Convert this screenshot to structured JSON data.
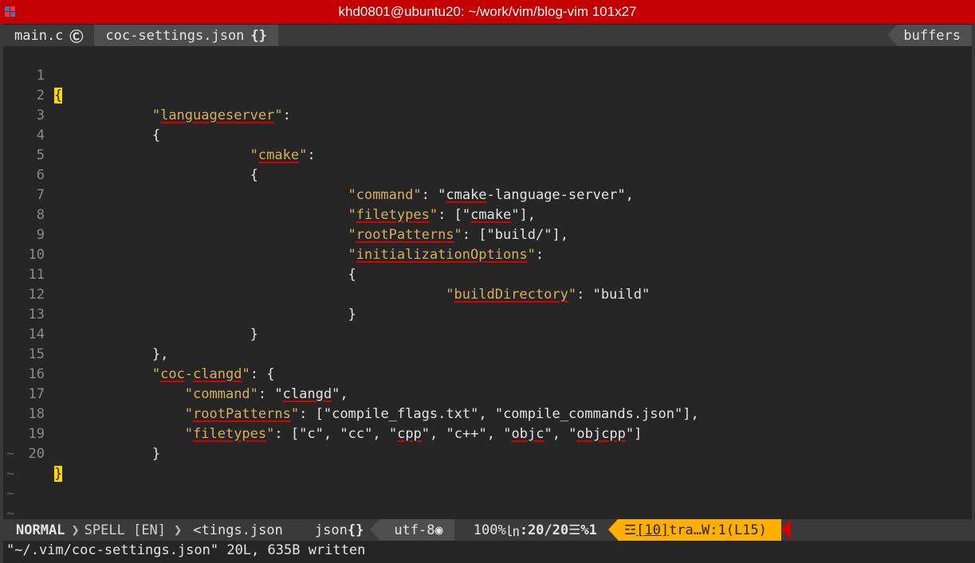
{
  "window": {
    "title": "khd0801@ubuntu20: ~/work/vim/blog-vim 101x27"
  },
  "tabline": {
    "tabs": [
      {
        "label": "main.c",
        "icon": "c-file-icon",
        "glyph": "Ⓒ"
      },
      {
        "label": "coc-settings.json",
        "icon": "json-file-icon",
        "glyph": "{}"
      }
    ],
    "right_label": "buffers"
  },
  "editor": {
    "lines": [
      {
        "n": "1"
      },
      {
        "n": "2"
      },
      {
        "n": "3"
      },
      {
        "n": "4"
      },
      {
        "n": "5"
      },
      {
        "n": "6"
      },
      {
        "n": "7"
      },
      {
        "n": "8"
      },
      {
        "n": "9"
      },
      {
        "n": "10"
      },
      {
        "n": "11"
      },
      {
        "n": "12"
      },
      {
        "n": "13"
      },
      {
        "n": "14"
      },
      {
        "n": "15"
      },
      {
        "n": "16"
      },
      {
        "n": "17"
      },
      {
        "n": "18"
      },
      {
        "n": "19"
      },
      {
        "n": "20"
      }
    ],
    "text": {
      "brace_open": "{",
      "brace_close": "}",
      "bracket_open": "[",
      "bracket_close": "]",
      "colon": ": ",
      "comma": ",",
      "quote": "\"",
      "languageserver": "languageserver",
      "cmake_key": "cmake",
      "command": "command",
      "cmake_language_server": "cmake-language-server",
      "cmake_word": "cmake",
      "dash_language_server": "-language-server",
      "filetypes": "filetypes",
      "rootPatterns": "rootPatterns",
      "build_slash": "build/",
      "initializationOptions": "initializationOptions",
      "buildDirectory": "buildDirectory",
      "build": "build",
      "coc": "coc",
      "dash": "-",
      "clangd": "clangd",
      "compile_flags": "compile_flags.txt",
      "compile_commands": "compile_commands.json",
      "ft_c": "c",
      "ft_cc": "cc",
      "ft_cpp": "cpp",
      "ft_cxx": "c++",
      "ft_objc": "objc",
      "ft_objcpp": "objcpp"
    },
    "tildes": [
      "~",
      "~",
      "~",
      "~"
    ]
  },
  "statusline": {
    "mode": "NORMAL",
    "spell": "SPELL [EN]",
    "filename": "<tings.json",
    "filetype": "json",
    "filetype_glyph": "{}",
    "encoding": "utf-8",
    "os_glyph": "◉",
    "percent": "100%",
    "line_glyph": "㏑",
    "position": ":20/20",
    "col_glyph": "☰",
    "col": "%1",
    "warn_glyph": "☲",
    "warning_link": "[10]",
    "warning_text": "tra…W:1(L15)"
  },
  "cmdline": {
    "message": "\"~/.vim/coc-settings.json\" 20L, 635B written"
  },
  "colors": {
    "title_bar": "#c40000",
    "background": "#262626",
    "key": "#d7af5f",
    "spell_underline": "#d70000",
    "warning": "#ffaf00",
    "cursor": "#ffd700"
  }
}
